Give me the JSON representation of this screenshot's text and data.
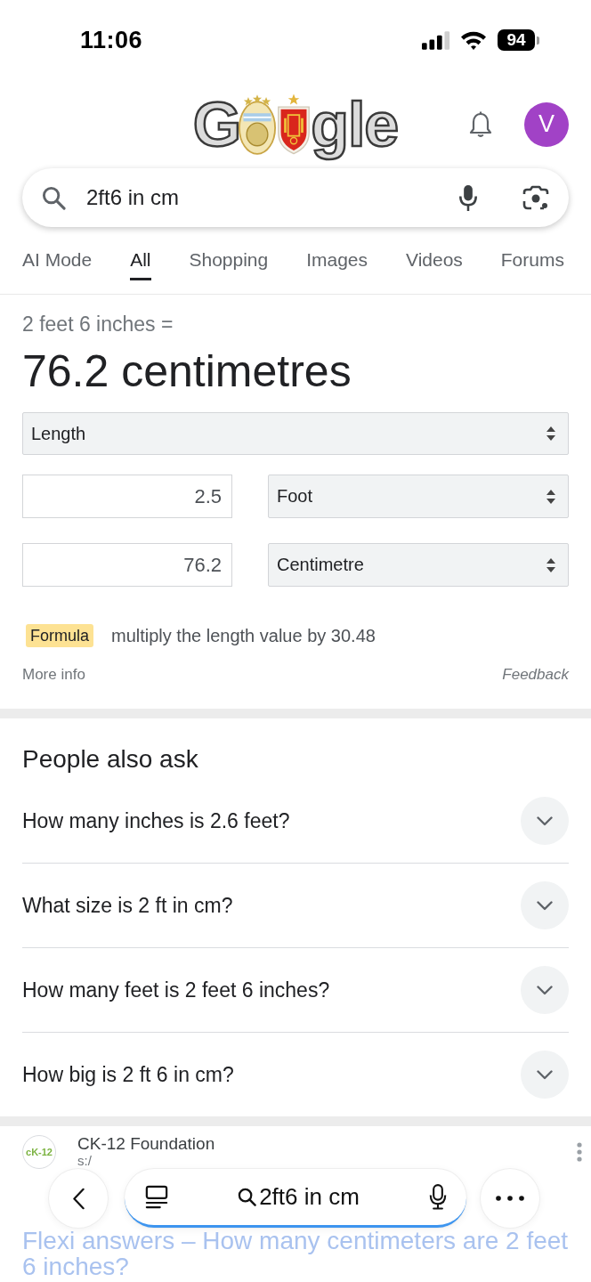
{
  "status_bar": {
    "time": "11:06",
    "battery": "94"
  },
  "header": {
    "logo": {
      "text_start": "G",
      "text_end": "gle"
    },
    "avatar_letter": "V"
  },
  "search": {
    "value": "2ft6 in cm"
  },
  "tabs": [
    {
      "label": "AI Mode",
      "selected": false
    },
    {
      "label": "All",
      "selected": true
    },
    {
      "label": "Shopping",
      "selected": false
    },
    {
      "label": "Images",
      "selected": false
    },
    {
      "label": "Videos",
      "selected": false
    },
    {
      "label": "Forums",
      "selected": false
    }
  ],
  "converter": {
    "query": "2 feet 6 inches =",
    "result": "76.2 centimetres",
    "quantity": "Length",
    "from": {
      "value": "2.5",
      "unit": "Foot"
    },
    "to": {
      "value": "76.2",
      "unit": "Centimetre"
    },
    "formula_label": "Formula",
    "formula": "multiply the length value by 30.48",
    "more_info": "More info",
    "feedback": "Feedback"
  },
  "people_also_ask": {
    "title": "People also ask",
    "questions": [
      {
        "text": "How many inches is 2.6 feet?",
        "expanded": false
      },
      {
        "text": "What size is 2 ft in cm?",
        "expanded": false
      },
      {
        "text": "How many feet is 2 feet 6 inches?",
        "expanded": false
      },
      {
        "text": "How big is 2 ft 6 in cm?",
        "expanded": false
      }
    ]
  },
  "result": {
    "logo_text": "cK-12",
    "source": "CK-12 Foundation",
    "url": "s:/",
    "title": "Flexi answers – How many centimeters are 2 feet 6 inches?"
  },
  "bottom_bar": {
    "query": "2ft6 in cm"
  }
}
